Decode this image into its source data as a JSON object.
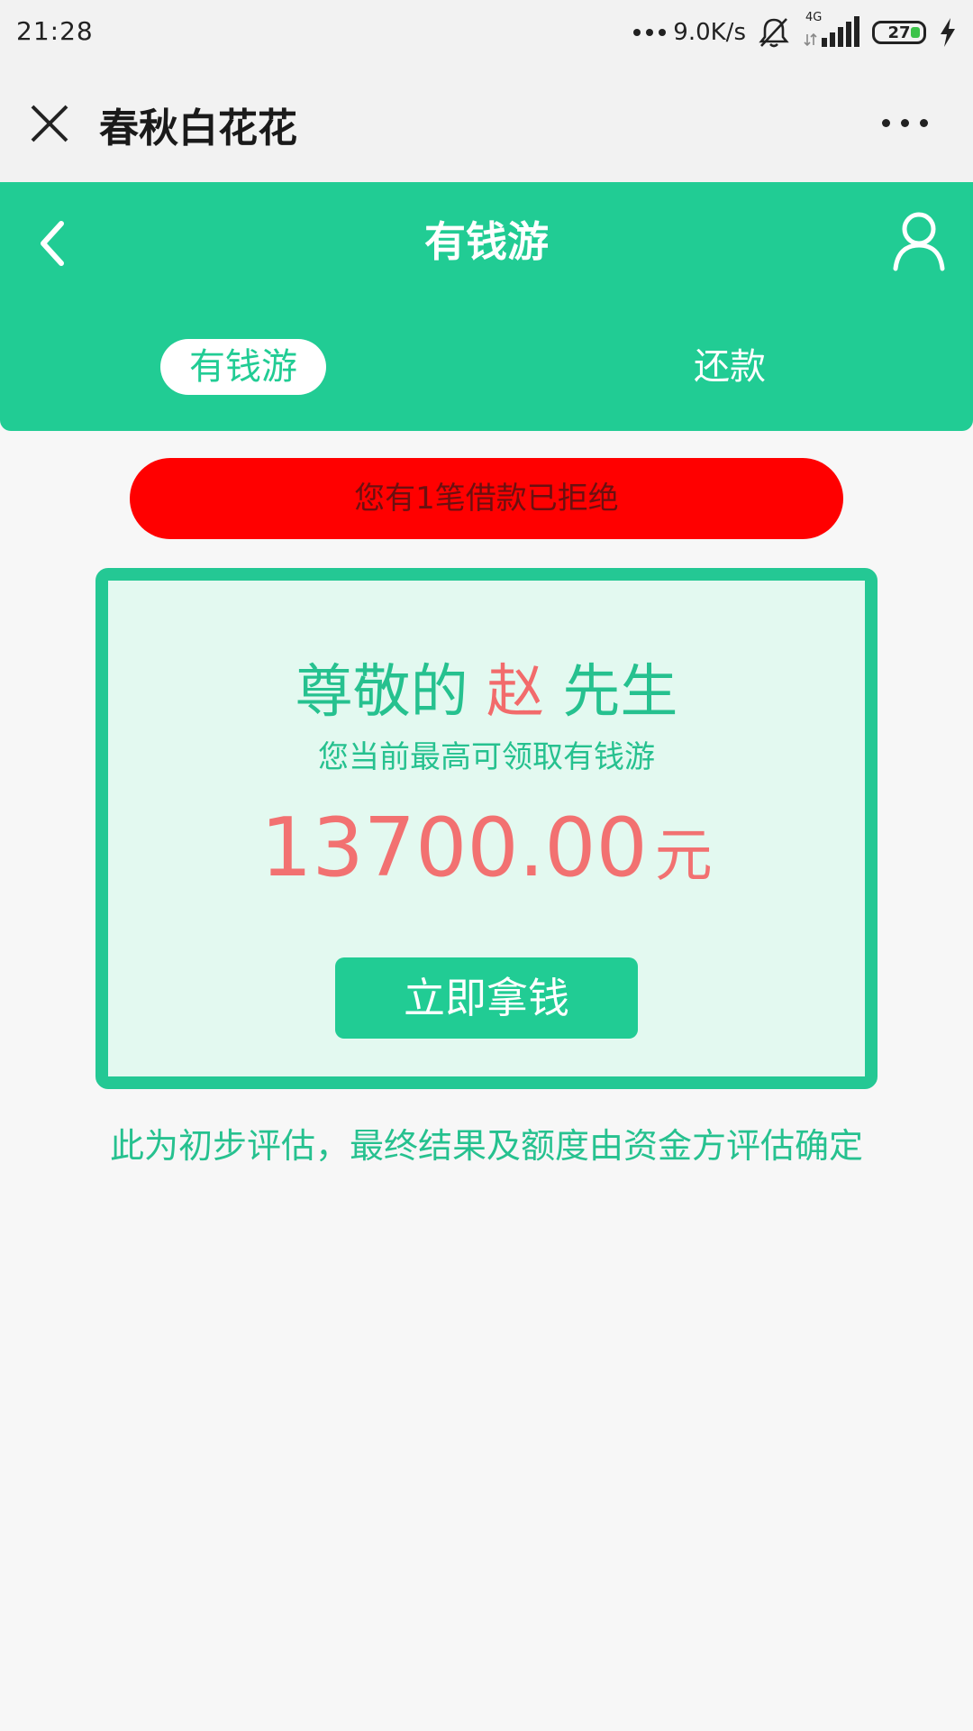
{
  "status_bar": {
    "time": "21:28",
    "net_speed": "9.0K/s",
    "network_type": "4G",
    "battery": "27",
    "icons": [
      "signal-dots-icon",
      "bell-muted-icon",
      "cell-signal-icon",
      "battery-icon",
      "charging-icon"
    ]
  },
  "mini_header": {
    "title": "春秋白花花",
    "icons": [
      "close-icon",
      "more-icon"
    ]
  },
  "app_header": {
    "title": "有钱游",
    "tabs": [
      {
        "label": "有钱游",
        "active": true
      },
      {
        "label": "还款",
        "active": false
      }
    ],
    "icons": [
      "back-icon",
      "user-icon"
    ]
  },
  "alert": {
    "text": "您有1笔借款已拒绝"
  },
  "card": {
    "greeting_prefix": "尊敬的",
    "surname": "赵",
    "greeting_suffix": "先生",
    "subtitle": "您当前最高可领取有钱游",
    "amount": "13700.00",
    "unit": "元",
    "button_label": "立即拿钱"
  },
  "note": "此为初步评估，最终结果及额度由资金方评估确定",
  "colors": {
    "brand_green": "#21cc94",
    "alert_red": "#ff0000",
    "amount_red": "#f27171",
    "card_bg": "#e3f9f0"
  }
}
